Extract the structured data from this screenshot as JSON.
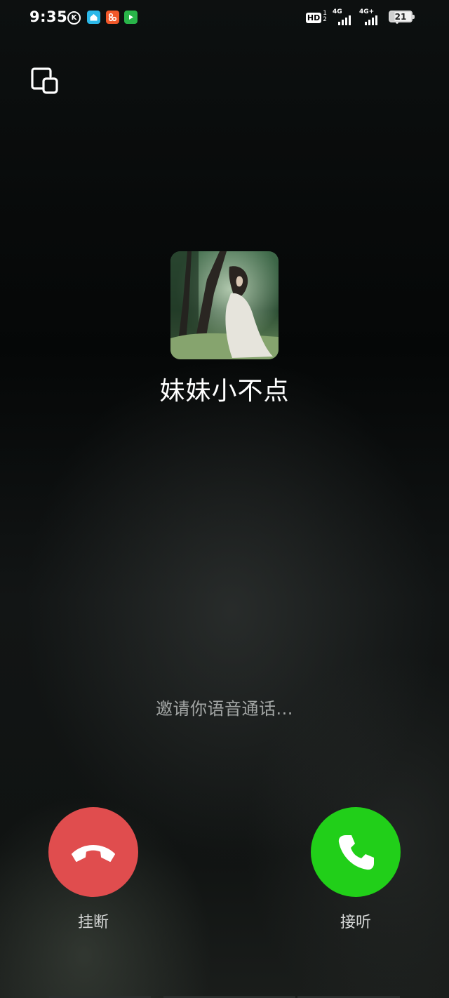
{
  "status_bar": {
    "time": "9:35",
    "app_icons": [
      "k-icon",
      "home-app-icon",
      "orange-app-icon",
      "green-video-app-icon"
    ],
    "hd_label": "HD",
    "hd_sim_1": "1",
    "hd_sim_2": "2",
    "signal_1_label": "4G",
    "signal_2_label": "4G+",
    "battery_level": "21"
  },
  "call": {
    "contact_name": "妹妹小不点",
    "status_text": "邀请你语音通话...",
    "hangup_label": "挂断",
    "answer_label": "接听"
  },
  "colors": {
    "hangup": "#e04d4e",
    "answer": "#21cf19",
    "background": "#0b0d0d"
  }
}
